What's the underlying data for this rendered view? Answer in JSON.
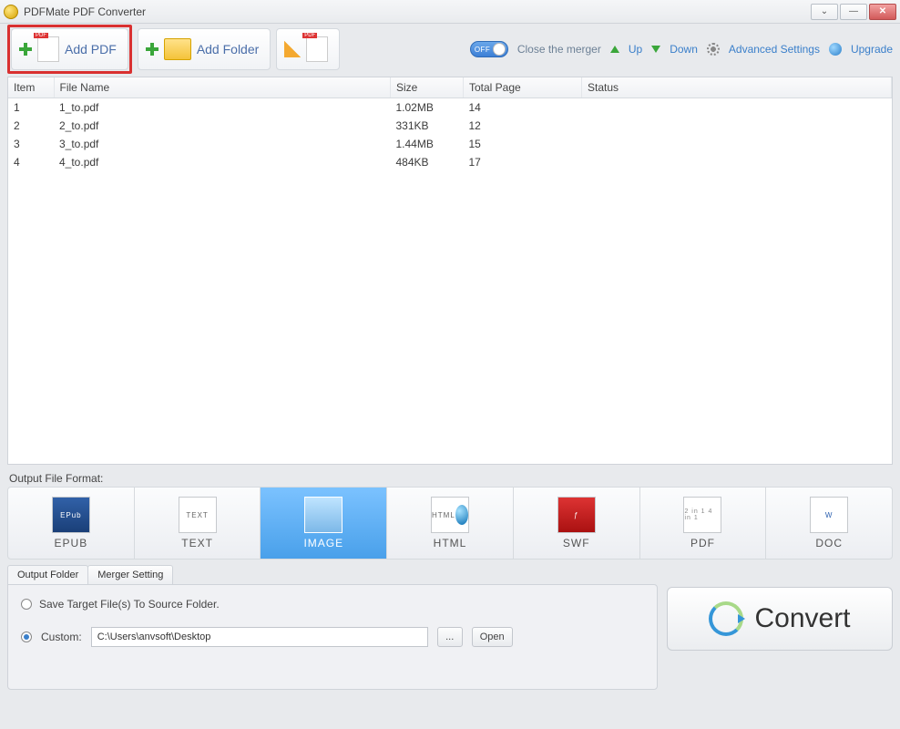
{
  "window": {
    "title": "PDFMate PDF Converter"
  },
  "toolbar": {
    "add_pdf": "Add PDF",
    "add_folder": "Add Folder",
    "close_merger": "Close the merger",
    "up": "Up",
    "down": "Down",
    "advanced": "Advanced Settings",
    "upgrade": "Upgrade",
    "off_label": "OFF"
  },
  "table": {
    "headers": {
      "item": "Item",
      "file": "File Name",
      "size": "Size",
      "total": "Total Page",
      "status": "Status"
    },
    "rows": [
      {
        "item": "1",
        "file": "1_to.pdf",
        "size": "1.02MB",
        "total": "14",
        "status": ""
      },
      {
        "item": "2",
        "file": "2_to.pdf",
        "size": "331KB",
        "total": "12",
        "status": ""
      },
      {
        "item": "3",
        "file": "3_to.pdf",
        "size": "1.44MB",
        "total": "15",
        "status": ""
      },
      {
        "item": "4",
        "file": "4_to.pdf",
        "size": "484KB",
        "total": "17",
        "status": ""
      }
    ]
  },
  "formats": {
    "label": "Output File Format:",
    "items": [
      {
        "name": "EPUB",
        "icon": "EPub",
        "selected": false
      },
      {
        "name": "TEXT",
        "icon": "TEXT",
        "selected": false
      },
      {
        "name": "IMAGE",
        "icon": "",
        "selected": true
      },
      {
        "name": "HTML",
        "icon": "HTML",
        "selected": false
      },
      {
        "name": "SWF",
        "icon": "ƒ",
        "selected": false
      },
      {
        "name": "PDF",
        "icon": "2 in 1\n4 in 1",
        "selected": false
      },
      {
        "name": "DOC",
        "icon": "W",
        "selected": false
      }
    ]
  },
  "output": {
    "tabs": {
      "folder": "Output Folder",
      "merger": "Merger Setting"
    },
    "save_source": "Save Target File(s) To Source Folder.",
    "custom_label": "Custom:",
    "custom_path": "C:\\Users\\anvsoft\\Desktop",
    "browse": "...",
    "open": "Open"
  },
  "convert": {
    "label": "Convert"
  }
}
